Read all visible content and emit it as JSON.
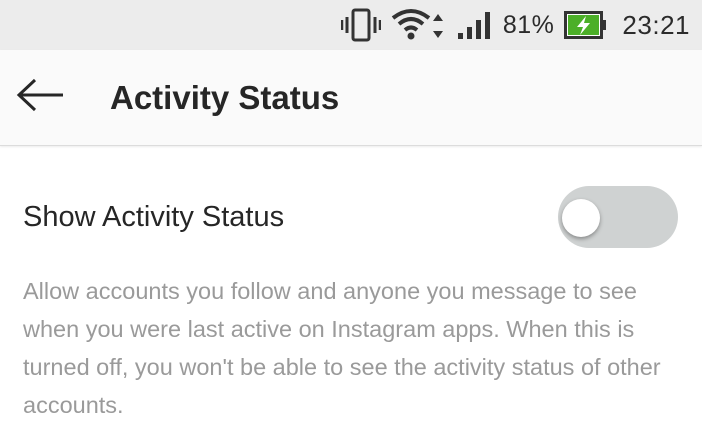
{
  "status_bar": {
    "battery_percent": "81%",
    "time": "23:21",
    "icons": [
      "vibrate-icon",
      "wifi-icon",
      "cell-signal-icon",
      "battery-charging-icon"
    ],
    "battery_color": "#4caf28"
  },
  "app_bar": {
    "back_icon": "arrow-left-icon",
    "title": "Activity Status"
  },
  "settings": {
    "show_activity_status": {
      "label": "Show Activity Status",
      "enabled": false,
      "description": "Allow accounts you follow and anyone you message to see when you were last active on Instagram apps. When this is turned off, you won't be able to see the activity status of other accounts."
    }
  },
  "colors": {
    "toggle_off_track": "#cfd2d2",
    "text_primary": "#262626",
    "text_secondary": "#9a9a9a"
  }
}
